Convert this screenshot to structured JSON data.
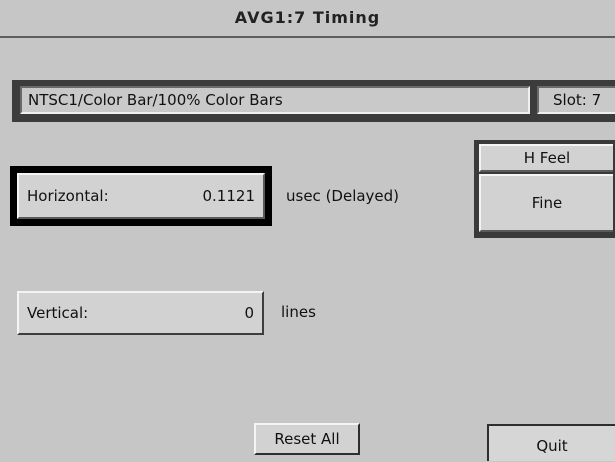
{
  "window": {
    "title": "AVG1:7  Timing"
  },
  "status": {
    "signal": "NTSC1/Color Bar/100% Color  Bars",
    "slot": "Slot: 7"
  },
  "horizontal": {
    "label": "Horizontal:",
    "value": "0.1121",
    "unit": "usec (Delayed)"
  },
  "vertical": {
    "label": "Vertical:",
    "value": "0",
    "unit": "lines"
  },
  "feel": {
    "title": "H Feel",
    "value": "Fine"
  },
  "buttons": {
    "reset_all": "Reset All",
    "quit": "Quit"
  },
  "colors": {
    "background": "#c6c6c6",
    "focus": "#000000",
    "panel_dark": "#3a3a3a"
  }
}
